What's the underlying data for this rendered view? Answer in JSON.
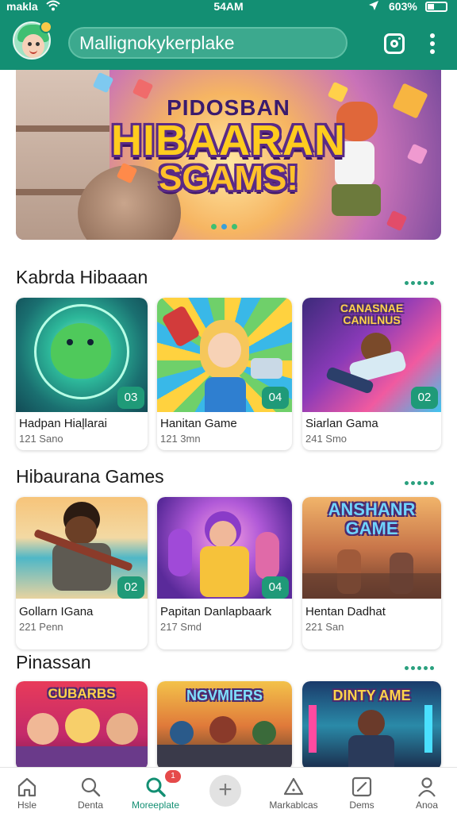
{
  "status_bar": {
    "carrier": "makla",
    "time": "54AM",
    "battery": "603%"
  },
  "header": {
    "search_text": "Mallignokykerplake",
    "avatar_icon": "avatar-icon",
    "instagram_icon": "instagram-icon",
    "more_icon": "kebab-menu-icon",
    "accent_color": "#138f73"
  },
  "banner": {
    "line1": "PIDOSBAN",
    "line2": "HIBAARAN",
    "line3": "SGAMS!",
    "page_dots": 3
  },
  "sections": [
    {
      "title": "Kabrda Hibaaan",
      "cards": [
        {
          "name": "Hadpan Hiaļlarai",
          "meta": "121 Sano",
          "badge": "03"
        },
        {
          "name": "Hanitan Game",
          "meta": "121 3mn",
          "badge": "04"
        },
        {
          "name": "Siarlan Gama",
          "meta": "241 Smo",
          "badge": "02",
          "overlay": "CANASNAE CANILNUS"
        }
      ]
    },
    {
      "title": "Hibaurana Games",
      "cards": [
        {
          "name": "Gollarn IGana",
          "meta": "221 Penn",
          "badge": "02"
        },
        {
          "name": "Papitan Danlapbaark",
          "meta": "217 Smd",
          "badge": "04"
        },
        {
          "name": "Hentan Dadhat",
          "meta": "221 San",
          "overlay": "ANSHANR GAME"
        }
      ]
    },
    {
      "title": "Pinassan",
      "cards": [
        {
          "overlay": "CUBARBS"
        },
        {
          "overlay": "NGVMIERS"
        },
        {
          "overlay": "DINTY AME"
        }
      ]
    }
  ],
  "bottom_nav": {
    "items": [
      {
        "label": "Hsle",
        "icon": "home-icon"
      },
      {
        "label": "Denta",
        "icon": "search-icon"
      },
      {
        "label": "Moreeplate",
        "icon": "search-active-icon",
        "active": true,
        "notification": "1"
      },
      {
        "label": "",
        "icon": "plus-icon"
      },
      {
        "label": "Markablcas",
        "icon": "warning-icon"
      },
      {
        "label": "Dems",
        "icon": "edit-icon"
      },
      {
        "label": "Anoa",
        "icon": "profile-icon"
      }
    ]
  }
}
